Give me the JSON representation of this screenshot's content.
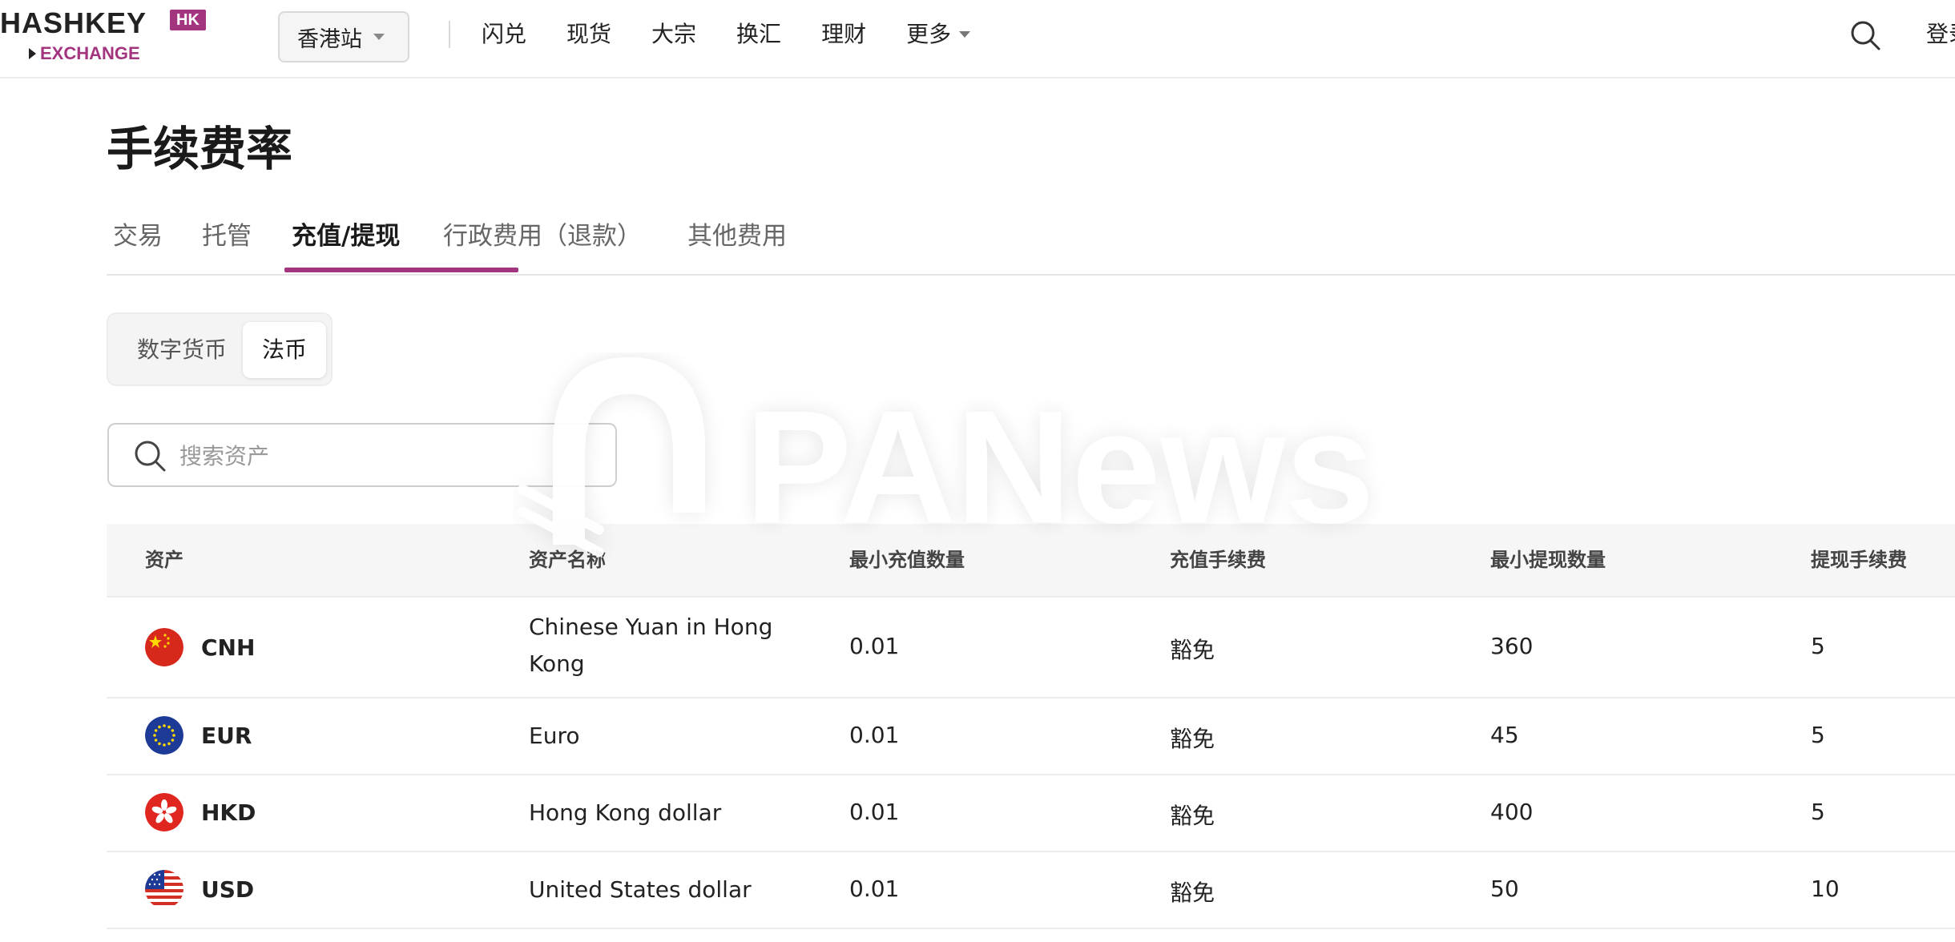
{
  "logo": {
    "main": "HASHKEY",
    "badge": "HK",
    "sub": "EXCHANGE"
  },
  "header": {
    "station_label": "香港站",
    "nav": [
      "闪兑",
      "现货",
      "大宗",
      "换汇",
      "理财",
      "更多"
    ],
    "login_label": "登录"
  },
  "page": {
    "title": "手续费率",
    "tabs": [
      "交易",
      "托管",
      "充值/提现",
      "行政费用（退款）",
      "其他费用"
    ],
    "active_tab": "充值/提现",
    "segments": [
      "数字货币",
      "法币"
    ],
    "active_segment": "法币",
    "search_placeholder": "搜索资产"
  },
  "watermark": {
    "text": "PANews"
  },
  "table": {
    "columns": [
      "资产",
      "资产名称",
      "最小充值数量",
      "充值手续费",
      "最小提现数量",
      "提现手续费"
    ],
    "rows": [
      {
        "asset": "CNH",
        "flag": "cn-flag-icon",
        "name": "Chinese Yuan in Hong Kong",
        "min_deposit": "0.01",
        "deposit_fee": "豁免",
        "min_withdraw": "360",
        "withdraw_fee": "5"
      },
      {
        "asset": "EUR",
        "flag": "eu-flag-icon",
        "name": "Euro",
        "min_deposit": "0.01",
        "deposit_fee": "豁免",
        "min_withdraw": "45",
        "withdraw_fee": "5"
      },
      {
        "asset": "HKD",
        "flag": "hk-flag-icon",
        "name": "Hong Kong dollar",
        "min_deposit": "0.01",
        "deposit_fee": "豁免",
        "min_withdraw": "400",
        "withdraw_fee": "5"
      },
      {
        "asset": "USD",
        "flag": "us-flag-icon",
        "name": "United States dollar",
        "min_deposit": "0.01",
        "deposit_fee": "豁免",
        "min_withdraw": "50",
        "withdraw_fee": "10"
      }
    ]
  },
  "colors": {
    "accent": "#a3357f",
    "text": "#1a1a1a",
    "muted": "#666666",
    "border": "#ececec"
  }
}
